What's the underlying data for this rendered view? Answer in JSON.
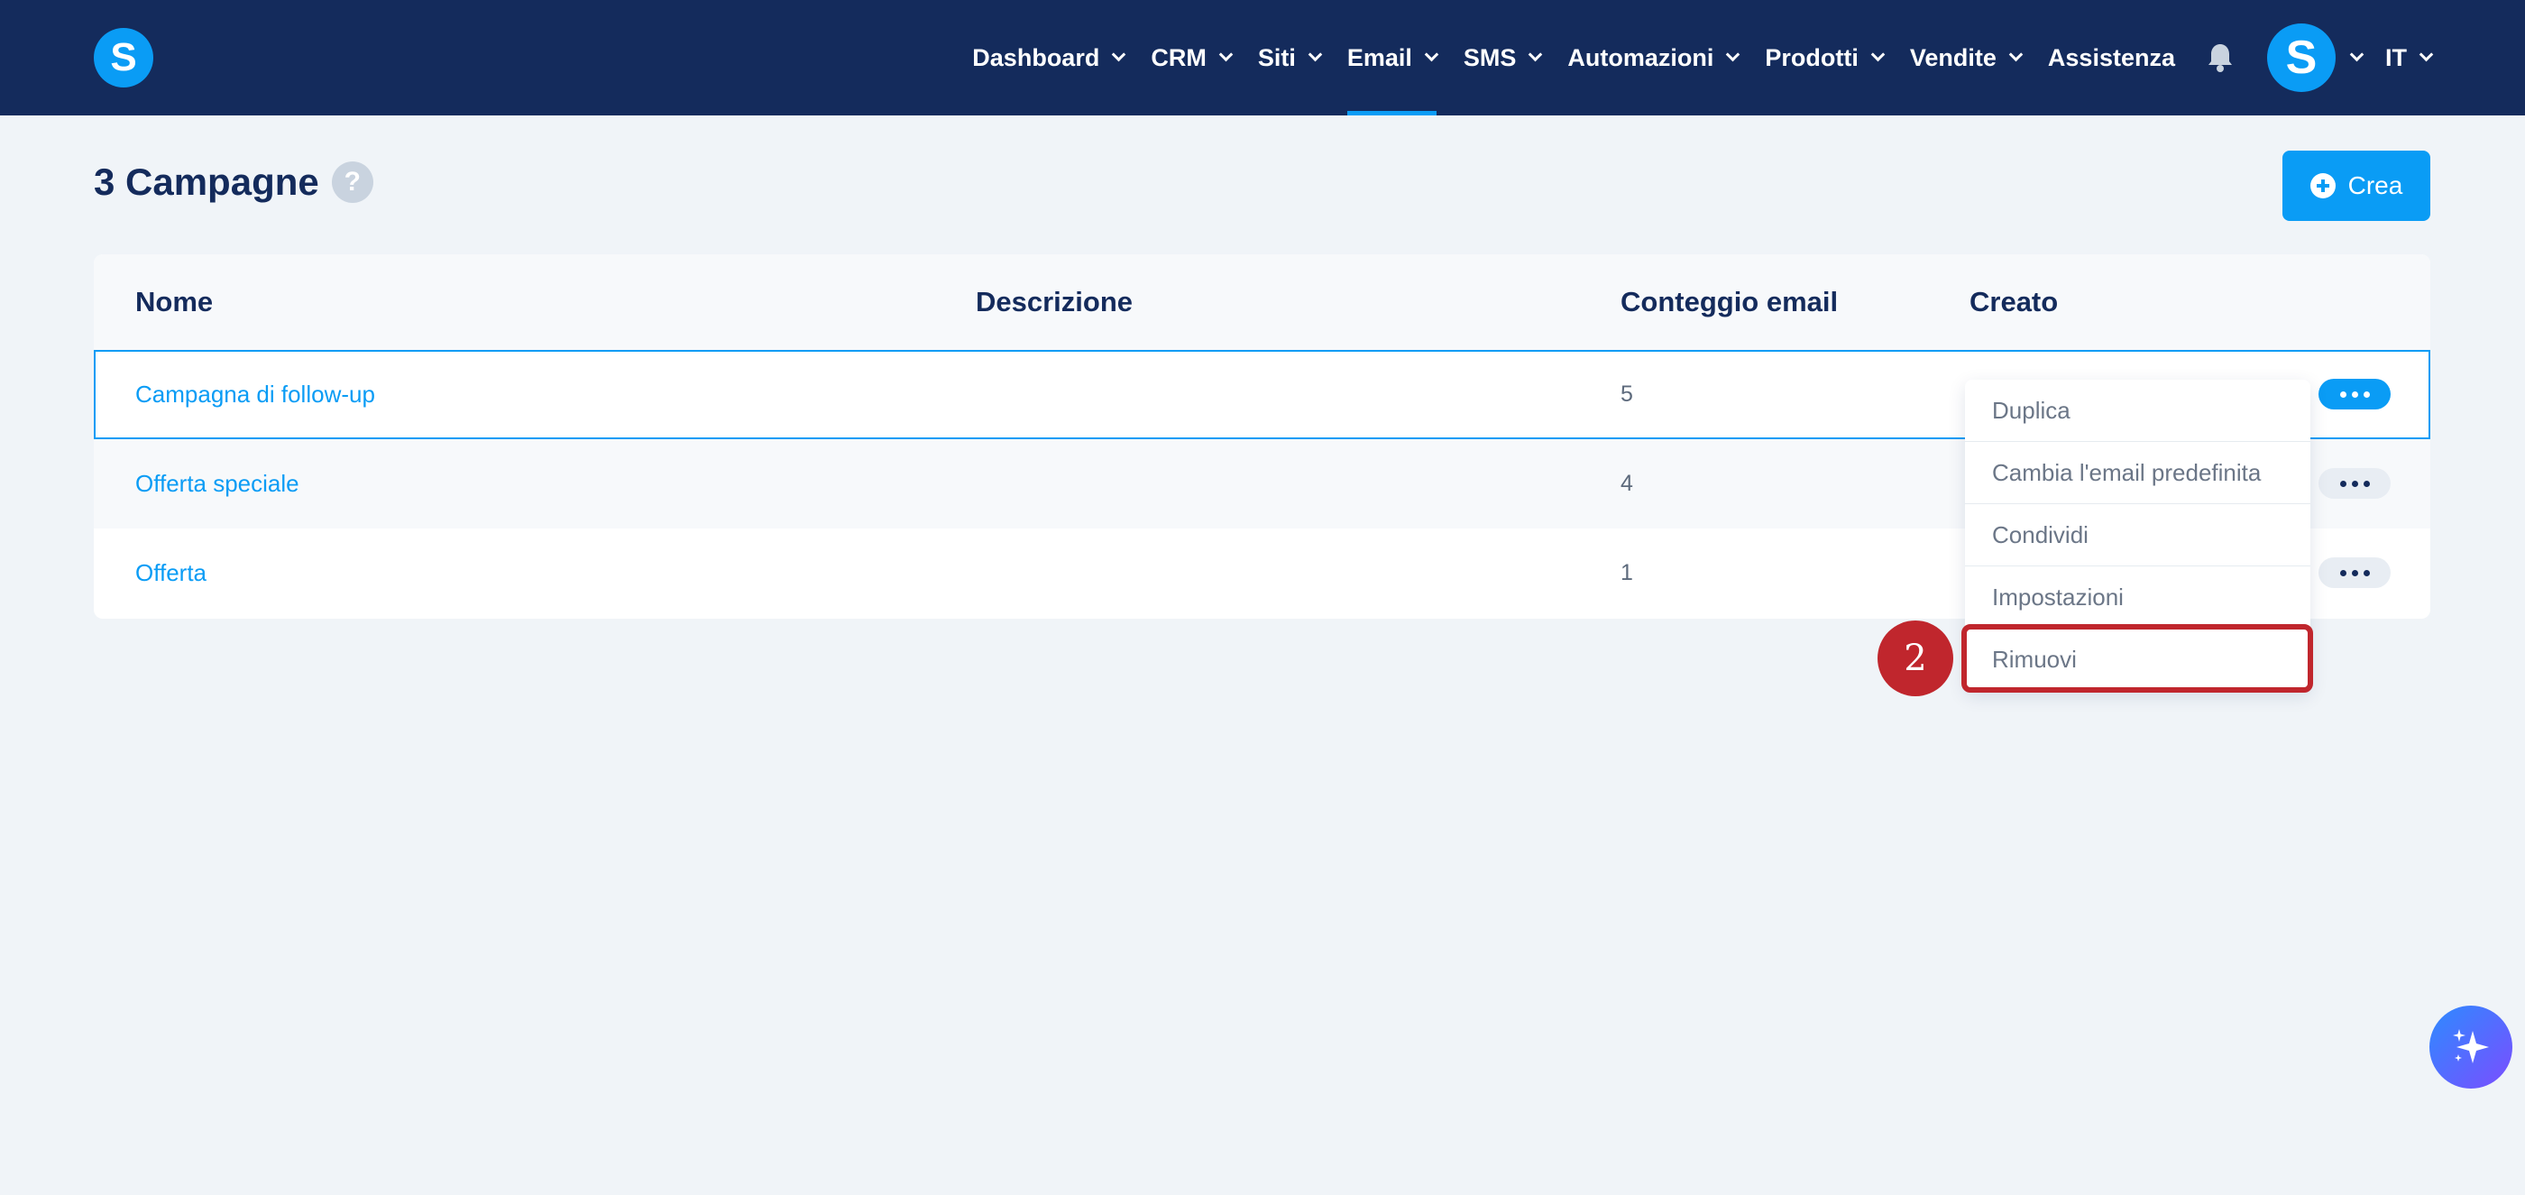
{
  "brand": {
    "logo_letter": "S",
    "accent": "#0a9cf5",
    "nav_bg": "#142b5c"
  },
  "nav": {
    "items": [
      {
        "label": "Dashboard",
        "has_dropdown": true
      },
      {
        "label": "CRM",
        "has_dropdown": true
      },
      {
        "label": "Siti",
        "has_dropdown": true
      },
      {
        "label": "Email",
        "has_dropdown": true,
        "active": true
      },
      {
        "label": "SMS",
        "has_dropdown": true
      },
      {
        "label": "Automazioni",
        "has_dropdown": true
      },
      {
        "label": "Prodotti",
        "has_dropdown": true
      },
      {
        "label": "Vendite",
        "has_dropdown": true
      },
      {
        "label": "Assistenza",
        "has_dropdown": false
      }
    ],
    "notifications_icon": "bell-icon",
    "avatar_letter": "S",
    "language": "IT"
  },
  "page": {
    "title": "3 Campagne",
    "help_icon": "?",
    "create_button": "Crea"
  },
  "table": {
    "columns": [
      "Nome",
      "Descrizione",
      "Conteggio email",
      "Creato"
    ],
    "rows": [
      {
        "name": "Campagna di follow-up",
        "description": "",
        "email_count": "5",
        "created": ""
      },
      {
        "name": "Offerta speciale",
        "description": "",
        "email_count": "4",
        "created": ""
      },
      {
        "name": "Offerta",
        "description": "",
        "email_count": "1",
        "created": ""
      }
    ]
  },
  "row_menu": {
    "items": [
      "Duplica",
      "Cambia l'email predefinita",
      "Condividi",
      "Impostazioni",
      "Rimuovi"
    ],
    "highlighted": "Rimuovi"
  },
  "annotation": {
    "step_number": "2",
    "color": "#c0262d"
  },
  "fab": {
    "icon": "sparkles-icon"
  }
}
